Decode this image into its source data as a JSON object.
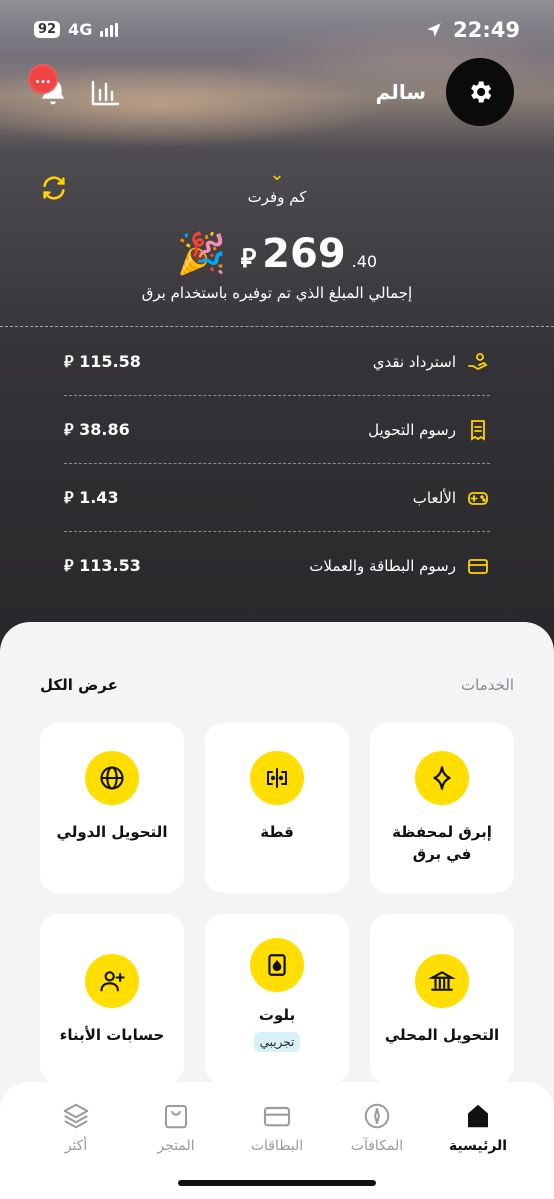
{
  "status_bar": {
    "battery": "92",
    "network": "4G",
    "time": "22:49"
  },
  "header": {
    "username": "سالم",
    "notification_badge": "..."
  },
  "savings": {
    "toggle_label": "كم وفرت",
    "total_integer": "269",
    "total_decimal": ".40",
    "currency_symbol": "⃁",
    "party_emoji": "🎉",
    "description": "إجمالي المبلغ الذي تم توفيره باستخدام برق",
    "items": [
      {
        "label": "استرداد نقدي",
        "amount": "115.58",
        "icon": "cashback-hand-icon"
      },
      {
        "label": "رسوم التحويل",
        "amount": "38.86",
        "icon": "receipt-icon"
      },
      {
        "label": "الألعاب",
        "amount": "1.43",
        "icon": "gamepad-icon"
      },
      {
        "label": "رسوم البطاقة والعملات",
        "amount": "113.53",
        "icon": "card-icon"
      }
    ]
  },
  "services": {
    "title": "الخدمات",
    "view_all": "عرض الكل",
    "tiles": [
      {
        "label": "إبرق لمحفظة في برق",
        "icon": "sparkle-icon"
      },
      {
        "label": "قطة",
        "icon": "split-icon"
      },
      {
        "label": "التحويل الدولي",
        "icon": "globe-icon"
      },
      {
        "label": "التحويل المحلي",
        "icon": "bank-icon"
      },
      {
        "label": "بلوت",
        "icon": "playing-card-icon",
        "tag": "تجريبي"
      },
      {
        "label": "حسابات الأبناء",
        "icon": "add-person-icon"
      }
    ]
  },
  "tab_bar": {
    "items": [
      {
        "label": "الرئيسية",
        "icon": "home-icon",
        "active": true
      },
      {
        "label": "المكافآت",
        "icon": "compass-icon"
      },
      {
        "label": "البطاقات",
        "icon": "card-icon"
      },
      {
        "label": "المتجر",
        "icon": "shopping-bag-icon"
      },
      {
        "label": "أكثر",
        "icon": "layers-icon"
      }
    ]
  },
  "colors": {
    "accent": "#ffde00",
    "dark": "#0b0b0b",
    "badge": "#f04444"
  }
}
